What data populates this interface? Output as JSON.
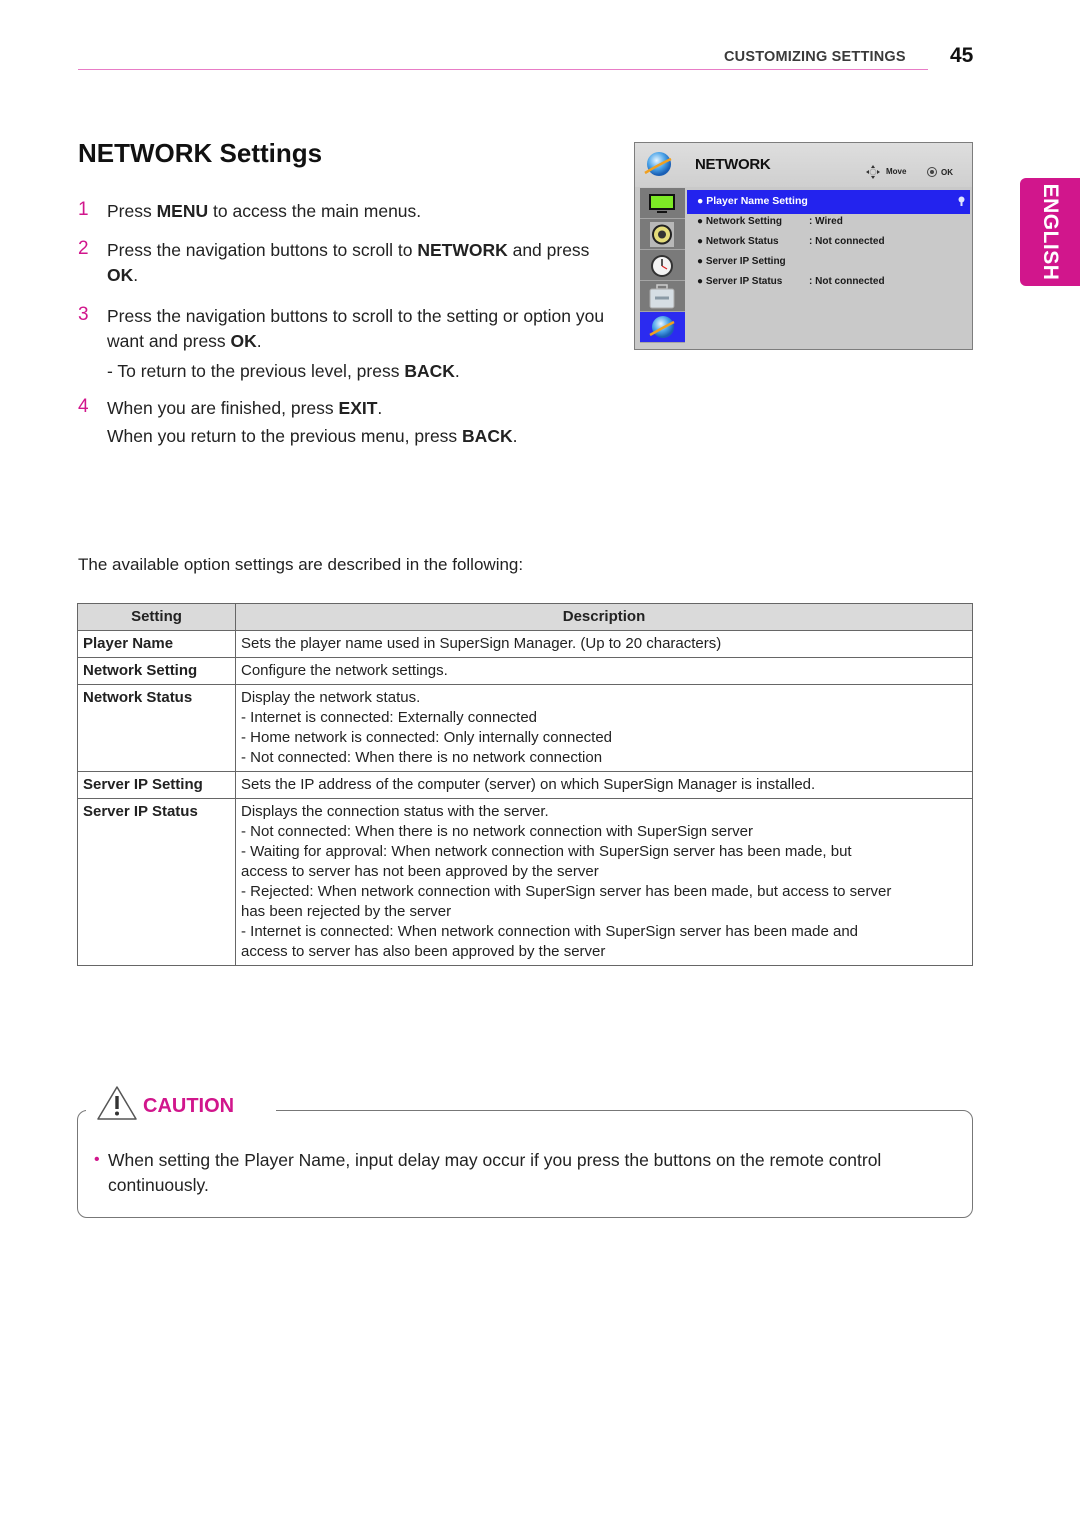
{
  "header": {
    "section_title": "CUSTOMIZING SETTINGS",
    "page_number": "45"
  },
  "language_tab": "ENGLISH",
  "page_title": "NETWORK Settings",
  "steps": [
    {
      "num": "1",
      "parts": [
        {
          "t": "Press "
        },
        {
          "t": "MENU",
          "b": true
        },
        {
          "t": " to access the main menus."
        }
      ]
    },
    {
      "num": "2",
      "parts": [
        {
          "t": "Press the navigation buttons to scroll to "
        },
        {
          "t": "NETWORK",
          "b": true
        },
        {
          "t": " and press "
        },
        {
          "t": "OK",
          "b": true
        },
        {
          "t": "."
        }
      ]
    },
    {
      "num": "3",
      "parts": [
        {
          "t": "Press the navigation buttons to scroll to the setting or option you want and press "
        },
        {
          "t": "OK",
          "b": true
        },
        {
          "t": "."
        }
      ]
    },
    {
      "num": "",
      "parts": [
        {
          "t": "- To return to the previous level, press "
        },
        {
          "t": "BACK",
          "b": true
        },
        {
          "t": "."
        }
      ]
    },
    {
      "num": "4",
      "parts": [
        {
          "t": "When you are finished, press "
        },
        {
          "t": "EXIT",
          "b": true
        },
        {
          "t": "."
        }
      ]
    },
    {
      "num": "",
      "parts": [
        {
          "t": "When you return to the previous menu, press "
        },
        {
          "t": "BACK",
          "b": true
        },
        {
          "t": "."
        }
      ]
    }
  ],
  "tv_menu": {
    "title": "NETWORK",
    "move_label": "Move",
    "ok_label": "OK",
    "side_icons": [
      "picture-icon",
      "audio-icon",
      "time-icon",
      "option-icon",
      "network-icon"
    ],
    "active_side_index": 4,
    "selected_item": "● Player Name Setting",
    "items": [
      {
        "label": "● Network Setting",
        "value": ": Wired"
      },
      {
        "label": "● Network Status",
        "value": ": Not connected"
      },
      {
        "label": "● Server IP Setting",
        "value": ""
      },
      {
        "label": "● Server IP Status",
        "value": ": Not connected"
      }
    ],
    "highlight_color": "#2323ee"
  },
  "intro_text": "The available option settings are described in the following:",
  "table": {
    "headers": [
      "Setting",
      "Description"
    ],
    "rows": [
      {
        "setting": "Player Name",
        "desc": [
          "Sets the player name used in SuperSign Manager. (Up to 20 characters)"
        ]
      },
      {
        "setting": "Network Setting",
        "desc": [
          "Configure the network settings."
        ]
      },
      {
        "setting": "Network Status",
        "desc": [
          "Display the network status.",
          "- Internet is connected: Externally connected",
          "- Home network is connected: Only internally connected",
          "- Not connected: When there is no network connection"
        ]
      },
      {
        "setting": "Server IP Setting",
        "desc": [
          "Sets the IP address of the computer (server) on which SuperSign Manager is installed."
        ]
      },
      {
        "setting": "Server IP Status",
        "desc": [
          "Displays the connection status with the server.",
          "- Not connected: When there is no network connection with SuperSign server",
          "- Waiting for approval: When network connection with SuperSign server has been made, but",
          "access to server has not been approved by the server",
          "- Rejected: When network connection with SuperSign server has been made, but access to server",
          "has been rejected by the server",
          "- Internet is connected: When network connection with SuperSign server has been made and",
          "access to server has also been approved by the server"
        ]
      }
    ]
  },
  "caution": {
    "label": "CAUTION",
    "bullet": "•",
    "text": "When setting the Player Name, input delay may occur if you press the buttons on the remote control continuously."
  },
  "colors": {
    "accent": "#d1168c",
    "rule": "#e87cc6",
    "table_header_bg": "#dadada"
  }
}
